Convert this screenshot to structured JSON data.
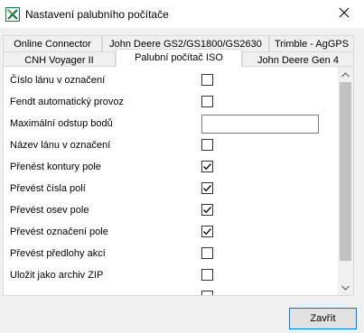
{
  "window": {
    "title": "Nastavení palubního počítače",
    "icon": "excel-app-icon",
    "close_icon": "close-icon"
  },
  "tabs_row1": [
    {
      "label": "Online Connector"
    },
    {
      "label": "John Deere GS2/GS1800/GS2630"
    },
    {
      "label": "Trimble - AgGPS"
    }
  ],
  "tabs_row2": [
    {
      "label": "CNH Voyager II"
    },
    {
      "label": "Palubní počítač ISO",
      "active": true
    },
    {
      "label": "John Deere Gen 4"
    }
  ],
  "settings": [
    {
      "label": "Číslo lánu v označení",
      "type": "checkbox",
      "checked": false
    },
    {
      "label": "Fendt automatický provoz",
      "type": "checkbox",
      "checked": false
    },
    {
      "label": "Maximální odstup bodů",
      "type": "text",
      "value": ""
    },
    {
      "label": "Název lánu v označení",
      "type": "checkbox",
      "checked": false
    },
    {
      "label": "Přenést kontury pole",
      "type": "checkbox",
      "checked": true
    },
    {
      "label": "Převést čísla polí",
      "type": "checkbox",
      "checked": true
    },
    {
      "label": "Převést osev pole",
      "type": "checkbox",
      "checked": true
    },
    {
      "label": "Převést označení pole",
      "type": "checkbox",
      "checked": true
    },
    {
      "label": "Převést předlohy akcí",
      "type": "checkbox",
      "checked": false
    },
    {
      "label": "Uložit jako archiv ZIP",
      "type": "checkbox",
      "checked": false
    },
    {
      "label": "",
      "type": "checkbox",
      "checked": false
    }
  ],
  "buttons": {
    "close_label": "Zavřít"
  },
  "colors": {
    "accent": "#0078d7",
    "excel_green": "#1e7145"
  }
}
